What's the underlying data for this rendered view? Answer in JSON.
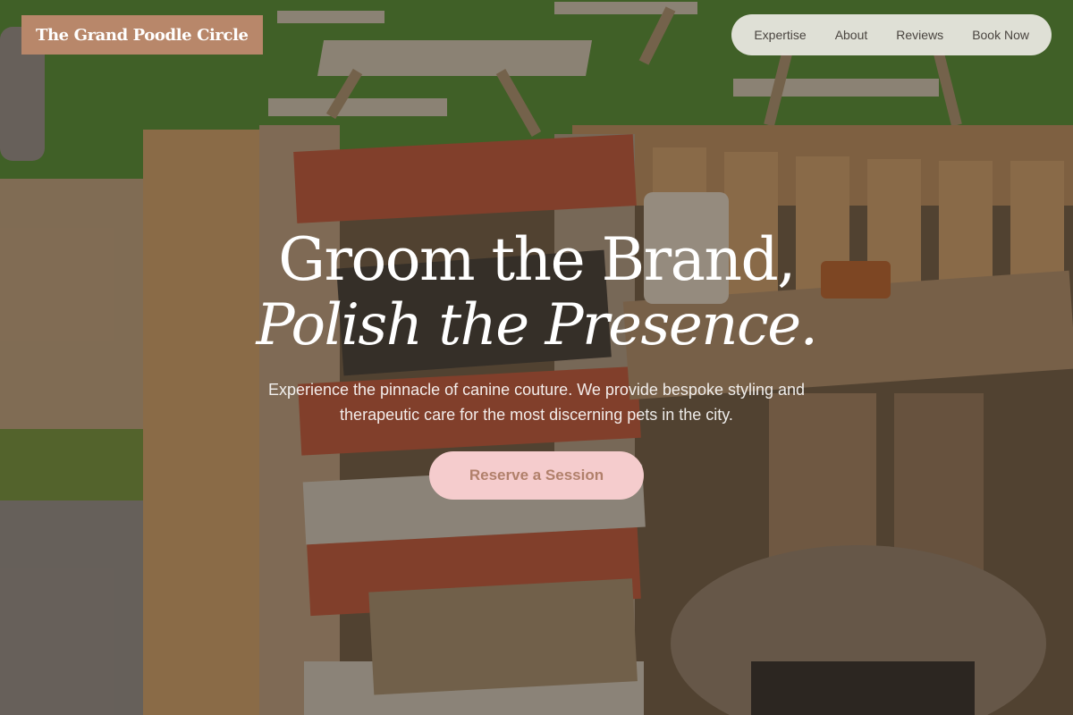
{
  "brand": {
    "name": "The Grand Poodle Circle"
  },
  "nav": {
    "items": [
      {
        "label": "Expertise"
      },
      {
        "label": "About"
      },
      {
        "label": "Reviews"
      },
      {
        "label": "Book Now"
      }
    ]
  },
  "hero": {
    "title_line1": "Groom the Brand,",
    "title_line2": "Polish the Presence.",
    "subtitle": "Experience the pinnacle of canine couture. We provide bespoke styling and therapeutic care for the most discerning pets in the city.",
    "cta_label": "Reserve a Session"
  },
  "colors": {
    "logo_bg": "#b8876a",
    "nav_bg": "#ece9e4",
    "cta_bg": "#f5cccd",
    "cta_text": "#b1806b"
  }
}
